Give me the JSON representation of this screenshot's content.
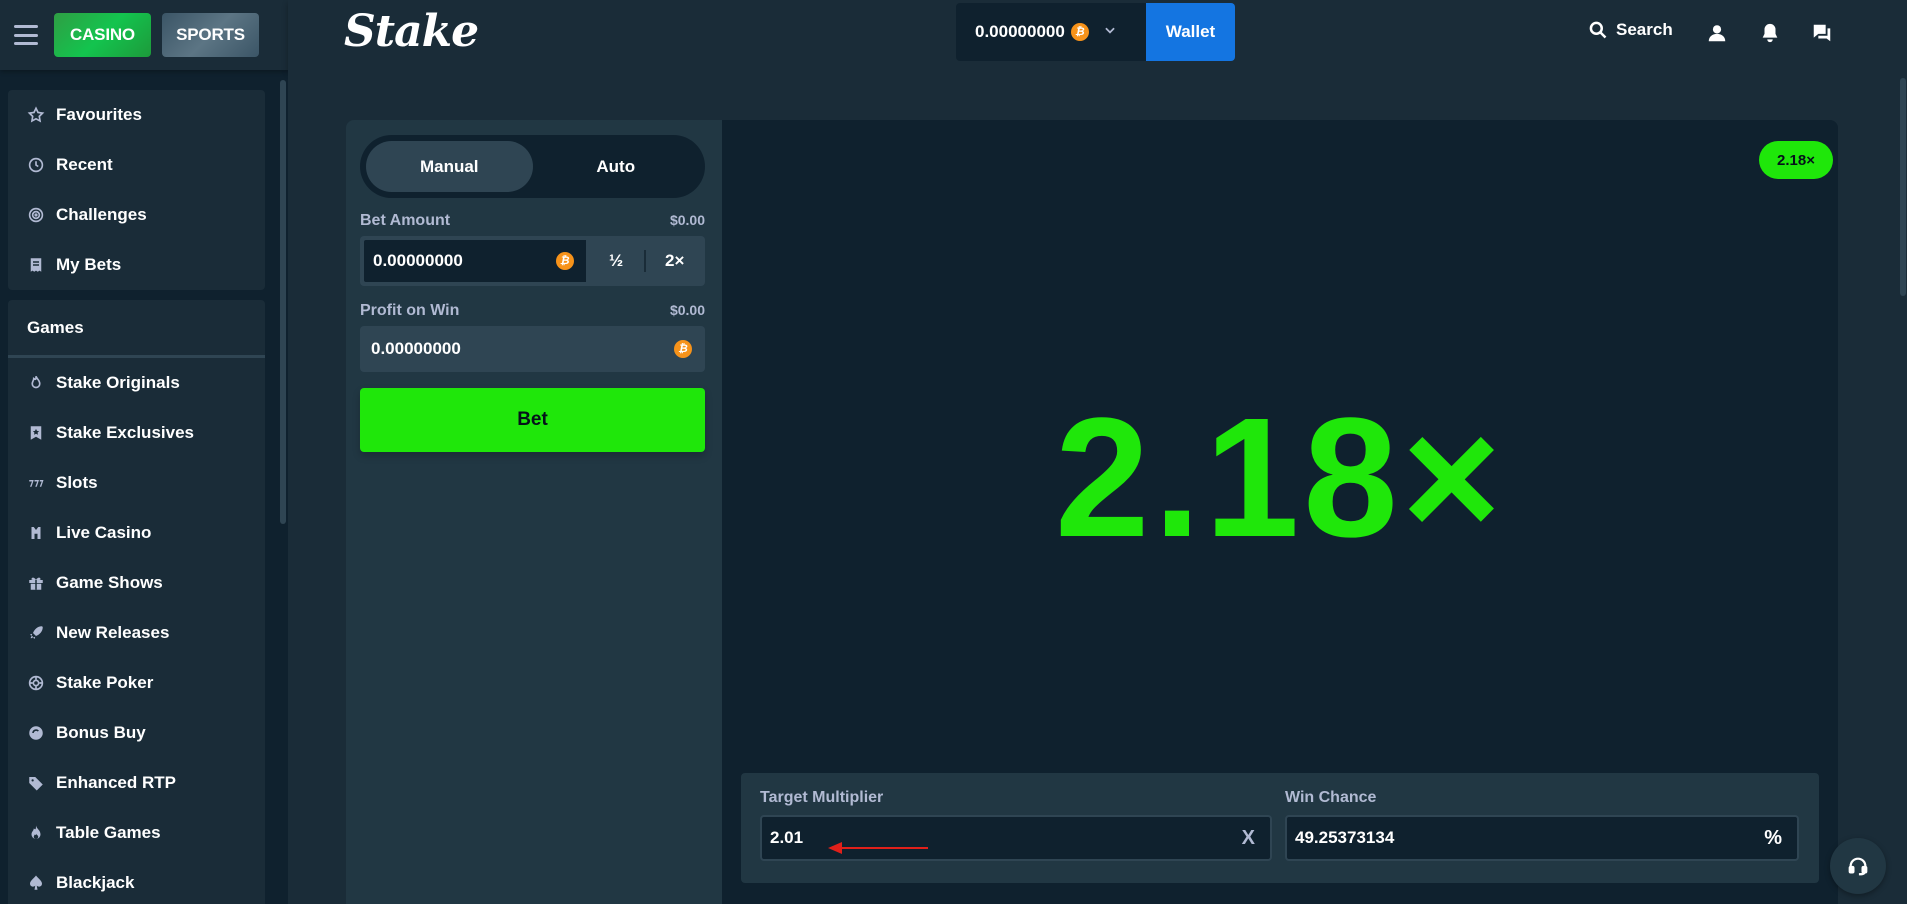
{
  "sidebar": {
    "casino_label": "CASINO",
    "sports_label": "SPORTS",
    "top_items": [
      {
        "label": "Favourites",
        "icon": "star-icon"
      },
      {
        "label": "Recent",
        "icon": "clock-icon"
      },
      {
        "label": "Challenges",
        "icon": "target-icon"
      },
      {
        "label": "My Bets",
        "icon": "receipt-icon"
      }
    ],
    "games_heading": "Games",
    "game_items": [
      {
        "label": "Stake Originals",
        "icon": "fire-icon"
      },
      {
        "label": "Stake Exclusives",
        "icon": "bookmark-star-icon"
      },
      {
        "label": "Slots",
        "icon": "slots-icon"
      },
      {
        "label": "Live Casino",
        "icon": "dealer-icon"
      },
      {
        "label": "Game Shows",
        "icon": "gift-icon"
      },
      {
        "label": "New Releases",
        "icon": "rocket-icon"
      },
      {
        "label": "Stake Poker",
        "icon": "poker-chip-icon"
      },
      {
        "label": "Bonus Buy",
        "icon": "bonus-icon"
      },
      {
        "label": "Enhanced RTP",
        "icon": "tag-icon"
      },
      {
        "label": "Table Games",
        "icon": "flame-icon"
      },
      {
        "label": "Blackjack",
        "icon": "spade-icon"
      }
    ]
  },
  "header": {
    "logo": "Stake",
    "balance": "0.00000000",
    "wallet_label": "Wallet",
    "search_label": "Search"
  },
  "controls": {
    "mode_manual": "Manual",
    "mode_auto": "Auto",
    "bet_amount_label": "Bet Amount",
    "bet_amount_usd": "$0.00",
    "bet_amount_value": "0.00000000",
    "half_label": "½",
    "double_label": "2×",
    "profit_label": "Profit on Win",
    "profit_usd": "$0.00",
    "profit_value": "0.00000000",
    "bet_button": "Bet"
  },
  "board": {
    "last_result_badge": "2.18×",
    "result_multiplier": "2.18×",
    "target_multiplier_label": "Target Multiplier",
    "target_multiplier_value": "2.01",
    "target_multiplier_suffix": "X",
    "win_chance_label": "Win Chance",
    "win_chance_value": "49.25373134",
    "win_chance_suffix": "%"
  },
  "colors": {
    "accent_green": "#1fe70a",
    "wallet_blue": "#1475e1",
    "bg_dark": "#0f212e",
    "bg_panel": "#213743",
    "bitcoin_orange": "#f7931a",
    "annotation_red": "#e0201a"
  }
}
